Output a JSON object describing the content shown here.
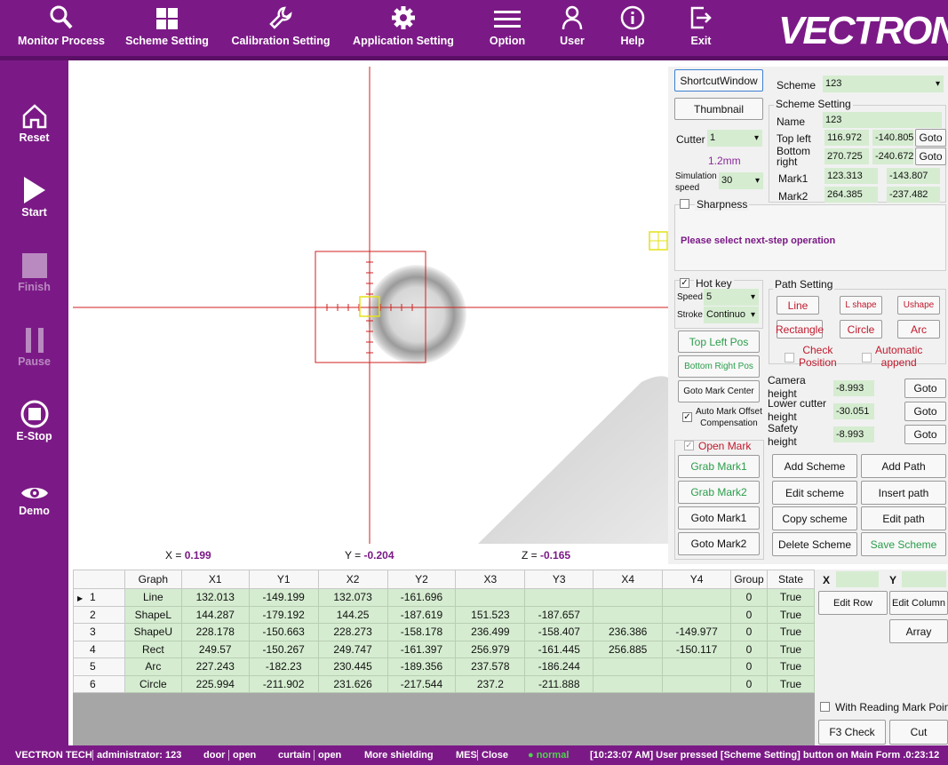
{
  "nav": {
    "monitor": "Monitor Process",
    "scheme": "Scheme Setting",
    "calibration": "Calibration Setting",
    "application": "Application Setting",
    "option": "Option",
    "user": "User",
    "help": "Help",
    "exit": "Exit",
    "logo": "VECTRON"
  },
  "side": {
    "reset": "Reset",
    "start": "Start",
    "finish": "Finish",
    "pause": "Pause",
    "estop": "E-Stop",
    "demo": "Demo"
  },
  "coords": {
    "x_label": "X = ",
    "x": "0.199",
    "y_label": "Y = ",
    "y": "-0.204",
    "z_label": "Z = ",
    "z": "-0.165"
  },
  "panel": {
    "shortcut": "ShortcutWindow",
    "thumbnail": "Thumbnail",
    "cutter_label": "Cutter",
    "cutter_value": "1",
    "cutter_size": "1.2mm",
    "sim_label_1": "Simulation",
    "sim_label_2": "speed",
    "sim_value": "30",
    "scheme_label": "Scheme",
    "scheme_value": "123",
    "scheme_setting_title": "Scheme Setting",
    "name_label": "Name",
    "name_value": "123",
    "top_left_label": "Top left",
    "top_left_x": "116.972",
    "top_left_y": "-140.805",
    "bottom_right_label_1": "Bottom",
    "bottom_right_label_2": "right",
    "bottom_right_x": "270.725",
    "bottom_right_y": "-240.672",
    "mark1_label": "Mark1",
    "mark1_x": "123.313",
    "mark1_y": "-143.807",
    "mark2_label": "Mark2",
    "mark2_x": "264.385",
    "mark2_y": "-237.482",
    "goto": "Goto",
    "sharpness": "Sharpness",
    "message": "Please select next-step operation",
    "hotkey": "Hot key",
    "speed_label": "Speed",
    "speed_value": "5",
    "stroke_label": "Stroke",
    "stroke_value": "Continuo",
    "top_left_pos": "Top Left Pos",
    "bottom_right_pos": "Bottom Right Pos",
    "goto_mark_center": "Goto Mark Center",
    "auto_mark_1": "Auto Mark Offset",
    "auto_mark_2": "Compensation",
    "open_mark": "Open Mark",
    "grab_mark1": "Grab Mark1",
    "grab_mark2": "Grab Mark2",
    "goto_mark1": "Goto Mark1",
    "goto_mark2": "Goto Mark2",
    "path_setting": "Path Setting",
    "line": "Line",
    "lshape": "L shape",
    "ushape": "Ushape",
    "rectangle": "Rectangle",
    "circle": "Circle",
    "arc": "Arc",
    "check_pos_1": "Check",
    "check_pos_2": "Position",
    "auto_append_1": "Automatic",
    "auto_append_2": "append",
    "camera_h_1": "Camera",
    "camera_h_2": "height",
    "camera_h": "-8.993",
    "lower_h_1": "Lower cutter",
    "lower_h_2": "height",
    "lower_h": "-30.051",
    "safety_h_1": "Safety",
    "safety_h_2": "height",
    "safety_h": "-8.993",
    "add_scheme": "Add Scheme",
    "add_path": "Add Path",
    "edit_scheme": "Edit scheme",
    "insert_path": "Insert path",
    "copy_scheme": "Copy scheme",
    "edit_path": "Edit path",
    "delete_scheme": "Delete Scheme",
    "save_scheme": "Save Scheme"
  },
  "grid": {
    "headers": [
      "Graph",
      "X1",
      "Y1",
      "X2",
      "Y2",
      "X3",
      "Y3",
      "X4",
      "Y4",
      "Group",
      "State"
    ],
    "rows": [
      [
        "1",
        "Line",
        "132.013",
        "-149.199",
        "132.073",
        "-161.696",
        "",
        "",
        "",
        "",
        "0",
        "True"
      ],
      [
        "2",
        "ShapeL",
        "144.287",
        "-179.192",
        "144.25",
        "-187.619",
        "151.523",
        "-187.657",
        "",
        "",
        "0",
        "True"
      ],
      [
        "3",
        "ShapeU",
        "228.178",
        "-150.663",
        "228.273",
        "-158.178",
        "236.499",
        "-158.407",
        "236.386",
        "-149.977",
        "0",
        "True"
      ],
      [
        "4",
        "Rect",
        "249.57",
        "-150.267",
        "249.747",
        "-161.397",
        "256.979",
        "-161.445",
        "256.885",
        "-150.117",
        "0",
        "True"
      ],
      [
        "5",
        "Arc",
        "227.243",
        "-182.23",
        "230.445",
        "-189.356",
        "237.578",
        "-186.244",
        "",
        "",
        "0",
        "True"
      ],
      [
        "6",
        "Circle",
        "225.994",
        "-211.902",
        "231.626",
        "-217.544",
        "237.2",
        "-211.888",
        "",
        "",
        "0",
        "True"
      ]
    ]
  },
  "gridside": {
    "x_label": "X",
    "y_label": "Y",
    "edit_row": "Edit Row",
    "edit_column": "Edit Column",
    "array": "Array",
    "reading_mark": "With Reading Mark Point",
    "f3": "F3 Check",
    "cut": "Cut"
  },
  "status": {
    "brand": "VECTRON TECH",
    "user": "administrator: 123",
    "door": "door",
    "door_state": "open",
    "curtain": "curtain",
    "curtain_state": "open",
    "shielding": "More shielding",
    "mes": "MES",
    "mes_state": "Close",
    "normal": "● normal",
    "log": "[10:23:07 AM] User pressed [Scheme Setting] button on Main Form .0:23:12"
  },
  "colors": {
    "brand_purple": "#7b1a86",
    "field_green": "#d5ecd0",
    "crosshair_red": "#d01f1f"
  }
}
